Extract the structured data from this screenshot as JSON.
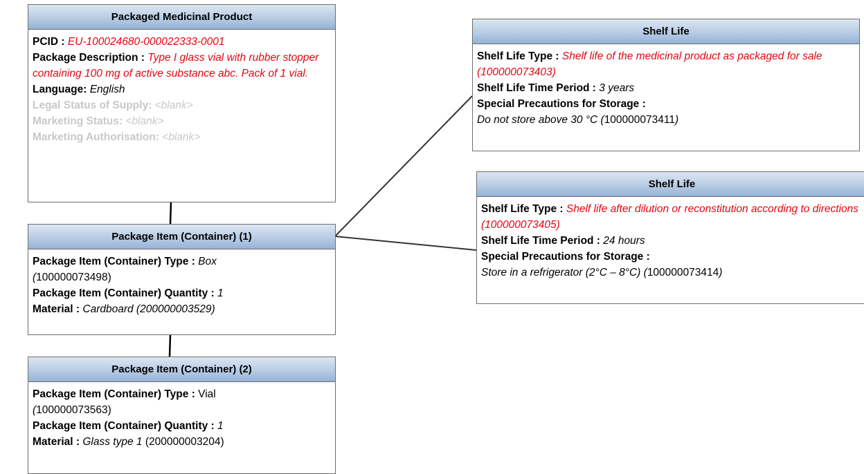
{
  "packaged_product": {
    "title": "Packaged Medicinal Product",
    "pcid_label": "PCID :",
    "pcid_value": "EU-100024680-000022333-0001",
    "desc_label": "Package Description :",
    "desc_value": "Type I glass vial with rubber stopper containing 100 mg of active substance abc. Pack of 1 vial.",
    "language_label": "Language:",
    "language_value": "English",
    "legal_label": "Legal Status of Supply:",
    "legal_value": "<blank>",
    "marketing_status_label": "Marketing Status:",
    "marketing_status_value": "<blank>",
    "marketing_auth_label": "Marketing Authorisation:",
    "marketing_auth_value": "<blank>"
  },
  "item1": {
    "title": "Package Item (Container) (1)",
    "type_label": "Package Item (Container) Type :",
    "type_value": "Box",
    "type_code_open": "(",
    "type_code": "100000073498)",
    "qty_label": "Package Item (Container) Quantity :",
    "qty_value": "1",
    "material_label": "Material :",
    "material_value": "Cardboard (200000003529)"
  },
  "item2": {
    "title": "Package Item (Container) (2)",
    "type_label": "Package Item (Container) Type :",
    "type_value": "Vial",
    "type_code_open": "(",
    "type_code": "100000073563)",
    "qty_label": "Package Item (Container) Quantity :",
    "qty_value": "1",
    "material_label": "Material :",
    "material_value": "Glass type 1",
    "material_code": "(200000003204)"
  },
  "shelf1": {
    "title": "Shelf Life",
    "type_label": "Shelf Life Type :",
    "type_value": "Shelf life of the medicinal product as packaged for sale (100000073403)",
    "period_label": "Shelf Life Time Period :",
    "period_value": "3 years",
    "storage_label": "Special Precautions for Storage :",
    "storage_value": "Do not store above 30 °C (",
    "storage_code": "100000073411",
    "storage_close": ")"
  },
  "shelf2": {
    "title": "Shelf Life",
    "type_label": "Shelf Life Type :",
    "type_value": "Shelf life after dilution or reconstitution according to directions (100000073405)",
    "period_label": "Shelf Life Time Period :",
    "period_value": "24 hours",
    "storage_label": "Special Precautions for Storage :",
    "storage_value": "Store in a refrigerator (2°C – 8°C) (",
    "storage_code": "100000073414",
    "storage_close": ")"
  },
  "colors": {
    "header_gradient_top": "#dce6f2",
    "header_gradient_bottom": "#95b3d7",
    "border": "#6d6d6d",
    "highlight_red": "#e30613",
    "placeholder_gray": "#c8c8c8"
  }
}
